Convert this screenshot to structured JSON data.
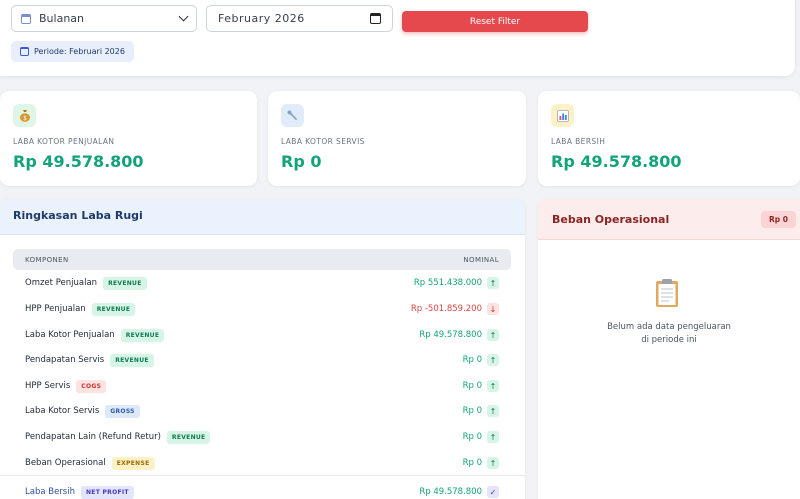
{
  "filters": {
    "period_type": "Bulanan",
    "month_value": "February 2026",
    "reset_label": "Reset Filter",
    "periode_label": "Periode: Februari 2026"
  },
  "stats": [
    {
      "label": "LABA KOTOR PENJUALAN",
      "value": "Rp 49.578.800",
      "icon": "money-bag-icon",
      "icon_bg": "#dff5e6"
    },
    {
      "label": "LABA KOTOR SERVIS",
      "value": "Rp 0",
      "icon": "wrench-icon",
      "icon_bg": "#e1ecfb"
    },
    {
      "label": "LABA BERSIH",
      "value": "Rp 49.578.800",
      "icon": "chart-icon",
      "icon_bg": "#fdf1c7"
    }
  ],
  "summary": {
    "title": "Ringkasan Laba Rugi",
    "col_component": "KOMPONEN",
    "col_nominal": "NOMINAL",
    "rows": [
      {
        "name": "Omzet Penjualan",
        "tag": "REVENUE",
        "amount": "Rp 551.438.000",
        "arrow": "↑"
      },
      {
        "name": "HPP Penjualan",
        "tag": "REVENUE",
        "amount": "Rp -501.859.200",
        "arrow": "↓"
      },
      {
        "name": "Laba Kotor Penjualan",
        "tag": "REVENUE",
        "amount": "Rp 49.578.800",
        "arrow": "↑"
      },
      {
        "name": "Pendapatan Servis",
        "tag": "REVENUE",
        "amount": "Rp 0",
        "arrow": "↑"
      },
      {
        "name": "HPP Servis",
        "tag": "COGS",
        "amount": "Rp 0",
        "arrow": "↑"
      },
      {
        "name": "Laba Kotor Servis",
        "tag": "GROSS",
        "amount": "Rp 0",
        "arrow": "↑"
      },
      {
        "name": "Pendapatan Lain (Refund Retur)",
        "tag": "REVENUE",
        "amount": "Rp 0",
        "arrow": "↑"
      },
      {
        "name": "Beban Operasional",
        "tag": "EXPENSE",
        "amount": "Rp 0",
        "arrow": "↑"
      },
      {
        "name": "Laba Bersih",
        "tag": "NET PROFIT",
        "amount": "Rp 49.578.800",
        "arrow": "✓"
      }
    ]
  },
  "expenses": {
    "title": "Beban Operasional",
    "badge": "Rp 0",
    "empty_line1": "Belum ada data pengeluaran",
    "empty_line2": "di periode ini"
  },
  "colors": {
    "accent_green": "#12a37a",
    "danger": "#e5484d",
    "negative": "#d64545"
  }
}
